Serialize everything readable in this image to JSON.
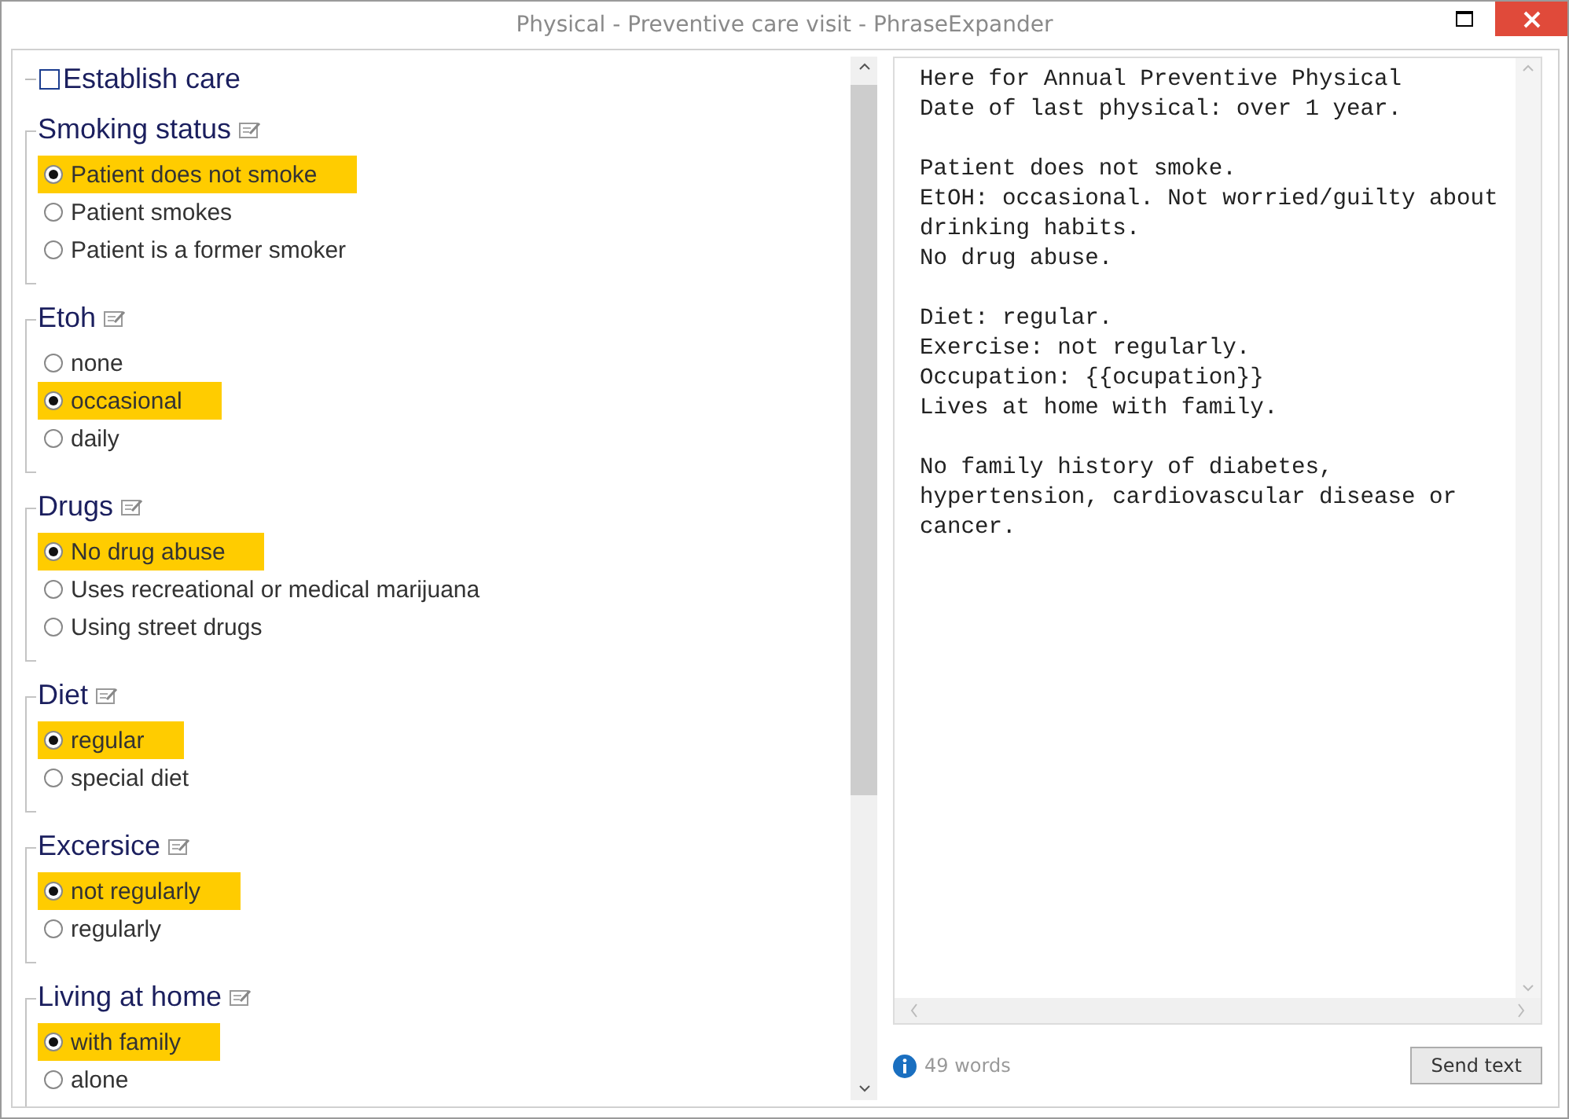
{
  "window": {
    "title": "Physical - Preventive care visit - PhraseExpander"
  },
  "establish": {
    "label": "Establish care",
    "checked": false
  },
  "groups": [
    {
      "title": "Smoking status",
      "options": [
        {
          "label": "Patient does not smoke",
          "selected": true
        },
        {
          "label": "Patient smokes",
          "selected": false
        },
        {
          "label": "Patient is a former smoker",
          "selected": false
        }
      ]
    },
    {
      "title": "Etoh",
      "options": [
        {
          "label": "none",
          "selected": false
        },
        {
          "label": "occasional",
          "selected": true
        },
        {
          "label": "daily",
          "selected": false
        }
      ]
    },
    {
      "title": "Drugs",
      "options": [
        {
          "label": "No drug abuse",
          "selected": true
        },
        {
          "label": "Uses recreational or medical marijuana",
          "selected": false
        },
        {
          "label": "Using street drugs",
          "selected": false
        }
      ]
    },
    {
      "title": "Diet",
      "options": [
        {
          "label": "regular",
          "selected": true
        },
        {
          "label": "special diet",
          "selected": false
        }
      ]
    },
    {
      "title": "Excersice",
      "options": [
        {
          "label": "not regularly",
          "selected": true
        },
        {
          "label": "regularly",
          "selected": false
        }
      ]
    },
    {
      "title": "Living at home",
      "options": [
        {
          "label": "with family",
          "selected": true
        },
        {
          "label": "alone",
          "selected": false
        }
      ]
    }
  ],
  "preview": {
    "paragraphs": [
      [
        "Here for Annual Preventive Physical",
        "Date of last physical: over 1 year."
      ],
      [
        "Patient does not smoke.",
        "EtOH: occasional. Not worried/guilty about",
        "drinking habits.",
        "No drug abuse."
      ],
      [
        "Diet: regular.",
        "Exercise: not regularly.",
        "Occupation: {{ocupation}}",
        "Lives at home with family."
      ],
      [
        "No family history of diabetes,",
        "hypertension, cardiovascular disease or",
        "cancer."
      ]
    ]
  },
  "status": {
    "word_count": "49 words"
  },
  "buttons": [
    "Send text"
  ]
}
